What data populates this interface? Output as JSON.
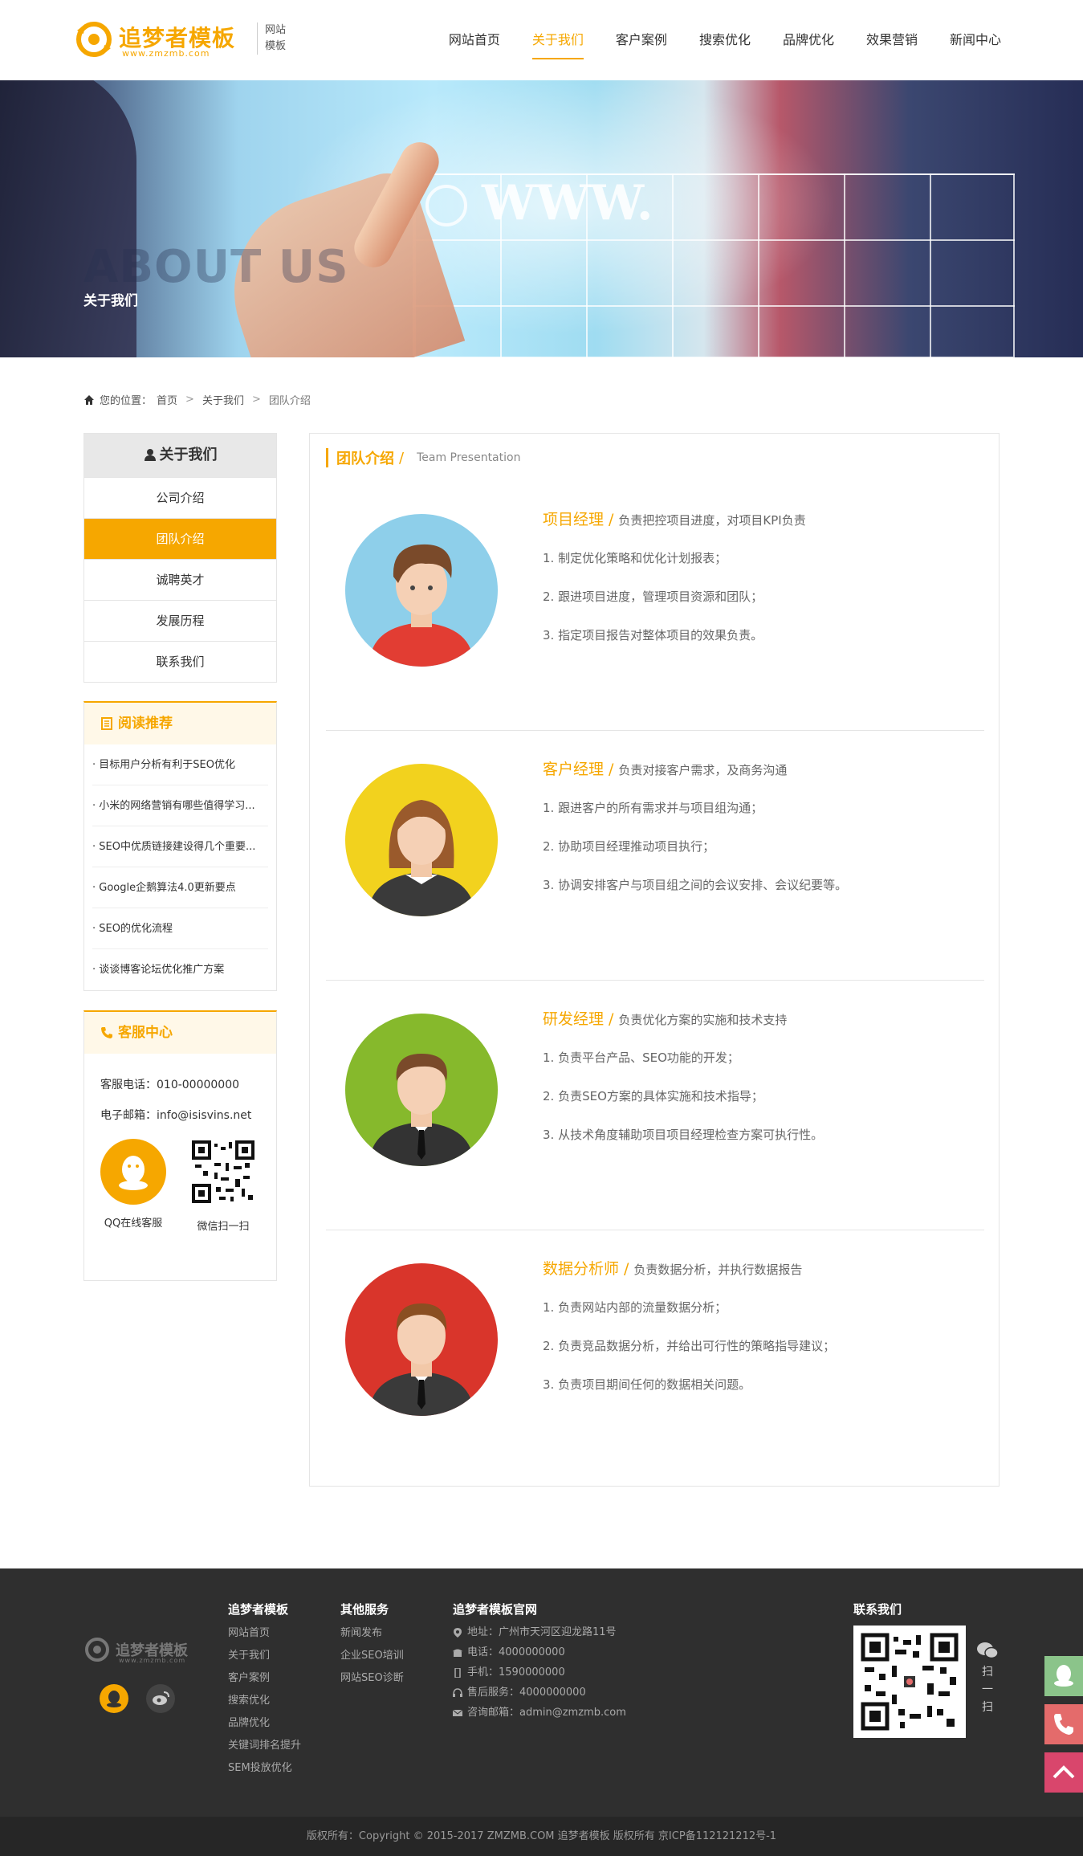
{
  "header": {
    "logo_title": "追梦者模板",
    "logo_url": "www.zmzmb.com",
    "logo_tag_1": "网站",
    "logo_tag_2": "模板",
    "nav": [
      {
        "label": "网站首页"
      },
      {
        "label": "关于我们",
        "active": true
      },
      {
        "label": "客户案例"
      },
      {
        "label": "搜索优化"
      },
      {
        "label": "品牌优化"
      },
      {
        "label": "效果营销"
      },
      {
        "label": "新闻中心"
      }
    ]
  },
  "banner": {
    "title_en": "ABOUT US",
    "title_cn": "关于我们",
    "www": "WWW."
  },
  "breadcrumb": {
    "prefix": "您的位置：",
    "items": [
      "首页",
      "关于我们",
      "团队介绍"
    ],
    "separator": ">"
  },
  "sidebar": {
    "head": "关于我们",
    "items": [
      {
        "label": "公司介绍"
      },
      {
        "label": "团队介绍",
        "active": true
      },
      {
        "label": "诚聘英才"
      },
      {
        "label": "发展历程"
      },
      {
        "label": "联系我们"
      }
    ]
  },
  "reading": {
    "head": "阅读推荐",
    "items": [
      "· 目标用户分析有利于SEO优化",
      "· 小米的网络营销有哪些值得学习...",
      "· SEO中优质链接建设得几个重要...",
      "· Google企鹅算法4.0更新要点",
      "· SEO的优化流程",
      "· 谈谈博客论坛优化推广方案"
    ]
  },
  "service": {
    "head": "客服中心",
    "phone": "客服电话：010-00000000",
    "email": "电子邮箱：info@isisvins.net",
    "qq_label": "QQ在线客服",
    "wechat_label": "微信扫一扫"
  },
  "main": {
    "title_cn": "团队介绍",
    "title_slash": "/",
    "title_en": "Team Presentation",
    "members": [
      {
        "title": "项目经理",
        "desc": "负责把控项目进度，对项目KPI负责",
        "lines": [
          "1. 制定优化策略和优化计划报表；",
          "2. 跟进项目进度，管理项目资源和团队；",
          "3. 指定项目报告对整体项目的效果负责。"
        ],
        "color": "#8ecfea"
      },
      {
        "title": "客户经理",
        "desc": "负责对接客户需求，及商务沟通",
        "lines": [
          "1. 跟进客户的所有需求并与项目组沟通；",
          "2. 协助项目经理推动项目执行；",
          "3. 协调安排客户与项目组之间的会议安排、会议纪要等。"
        ],
        "color": "#f2d21e"
      },
      {
        "title": "研发经理",
        "desc": "负责优化方案的实施和技术支持",
        "lines": [
          "1. 负责平台产品、SEO功能的开发；",
          "2. 负责SEO方案的具体实施和技术指导；",
          "3. 从技术角度辅助项目项目经理检查方案可执行性。"
        ],
        "color": "#86b92c"
      },
      {
        "title": "数据分析师",
        "desc": "负责数据分析，并执行数据报告",
        "lines": [
          "1. 负责网站内部的流量数据分析；",
          "2. 负责竞品数据分析，并给出可行性的策略指导建议；",
          "3. 负责项目期间任何的数据相关问题。"
        ],
        "color": "#d9352b"
      }
    ]
  },
  "footer": {
    "logo_text": "追梦者模板",
    "logo_url": "www.zmzmb.com",
    "col1": {
      "title": "追梦者模板",
      "links": [
        "网站首页",
        "关于我们",
        "客户案例",
        "搜索优化",
        "品牌优化",
        "关键词排名提升",
        "SEM投放优化"
      ]
    },
    "col2": {
      "title": "其他服务",
      "links": [
        "新闻发布",
        "企业SEO培训",
        "网站SEO诊断"
      ]
    },
    "col3": {
      "title": "追梦者模板官网",
      "info": [
        "地址：广州市天河区迎龙路11号",
        "电话：4000000000",
        "手机：1590000000",
        "售后服务：4000000000",
        "咨询邮箱：admin@zmzmb.com"
      ]
    },
    "contact_title": "联系我们",
    "scan": [
      "扫",
      "一",
      "扫"
    ],
    "copyright": "版权所有：Copyright © 2015-2017 ZMZMB.COM 追梦者模板 版权所有 京ICP备112121212号-1"
  },
  "colors": {
    "accent": "#f6a700",
    "footer_bg": "#2f2f2f"
  }
}
